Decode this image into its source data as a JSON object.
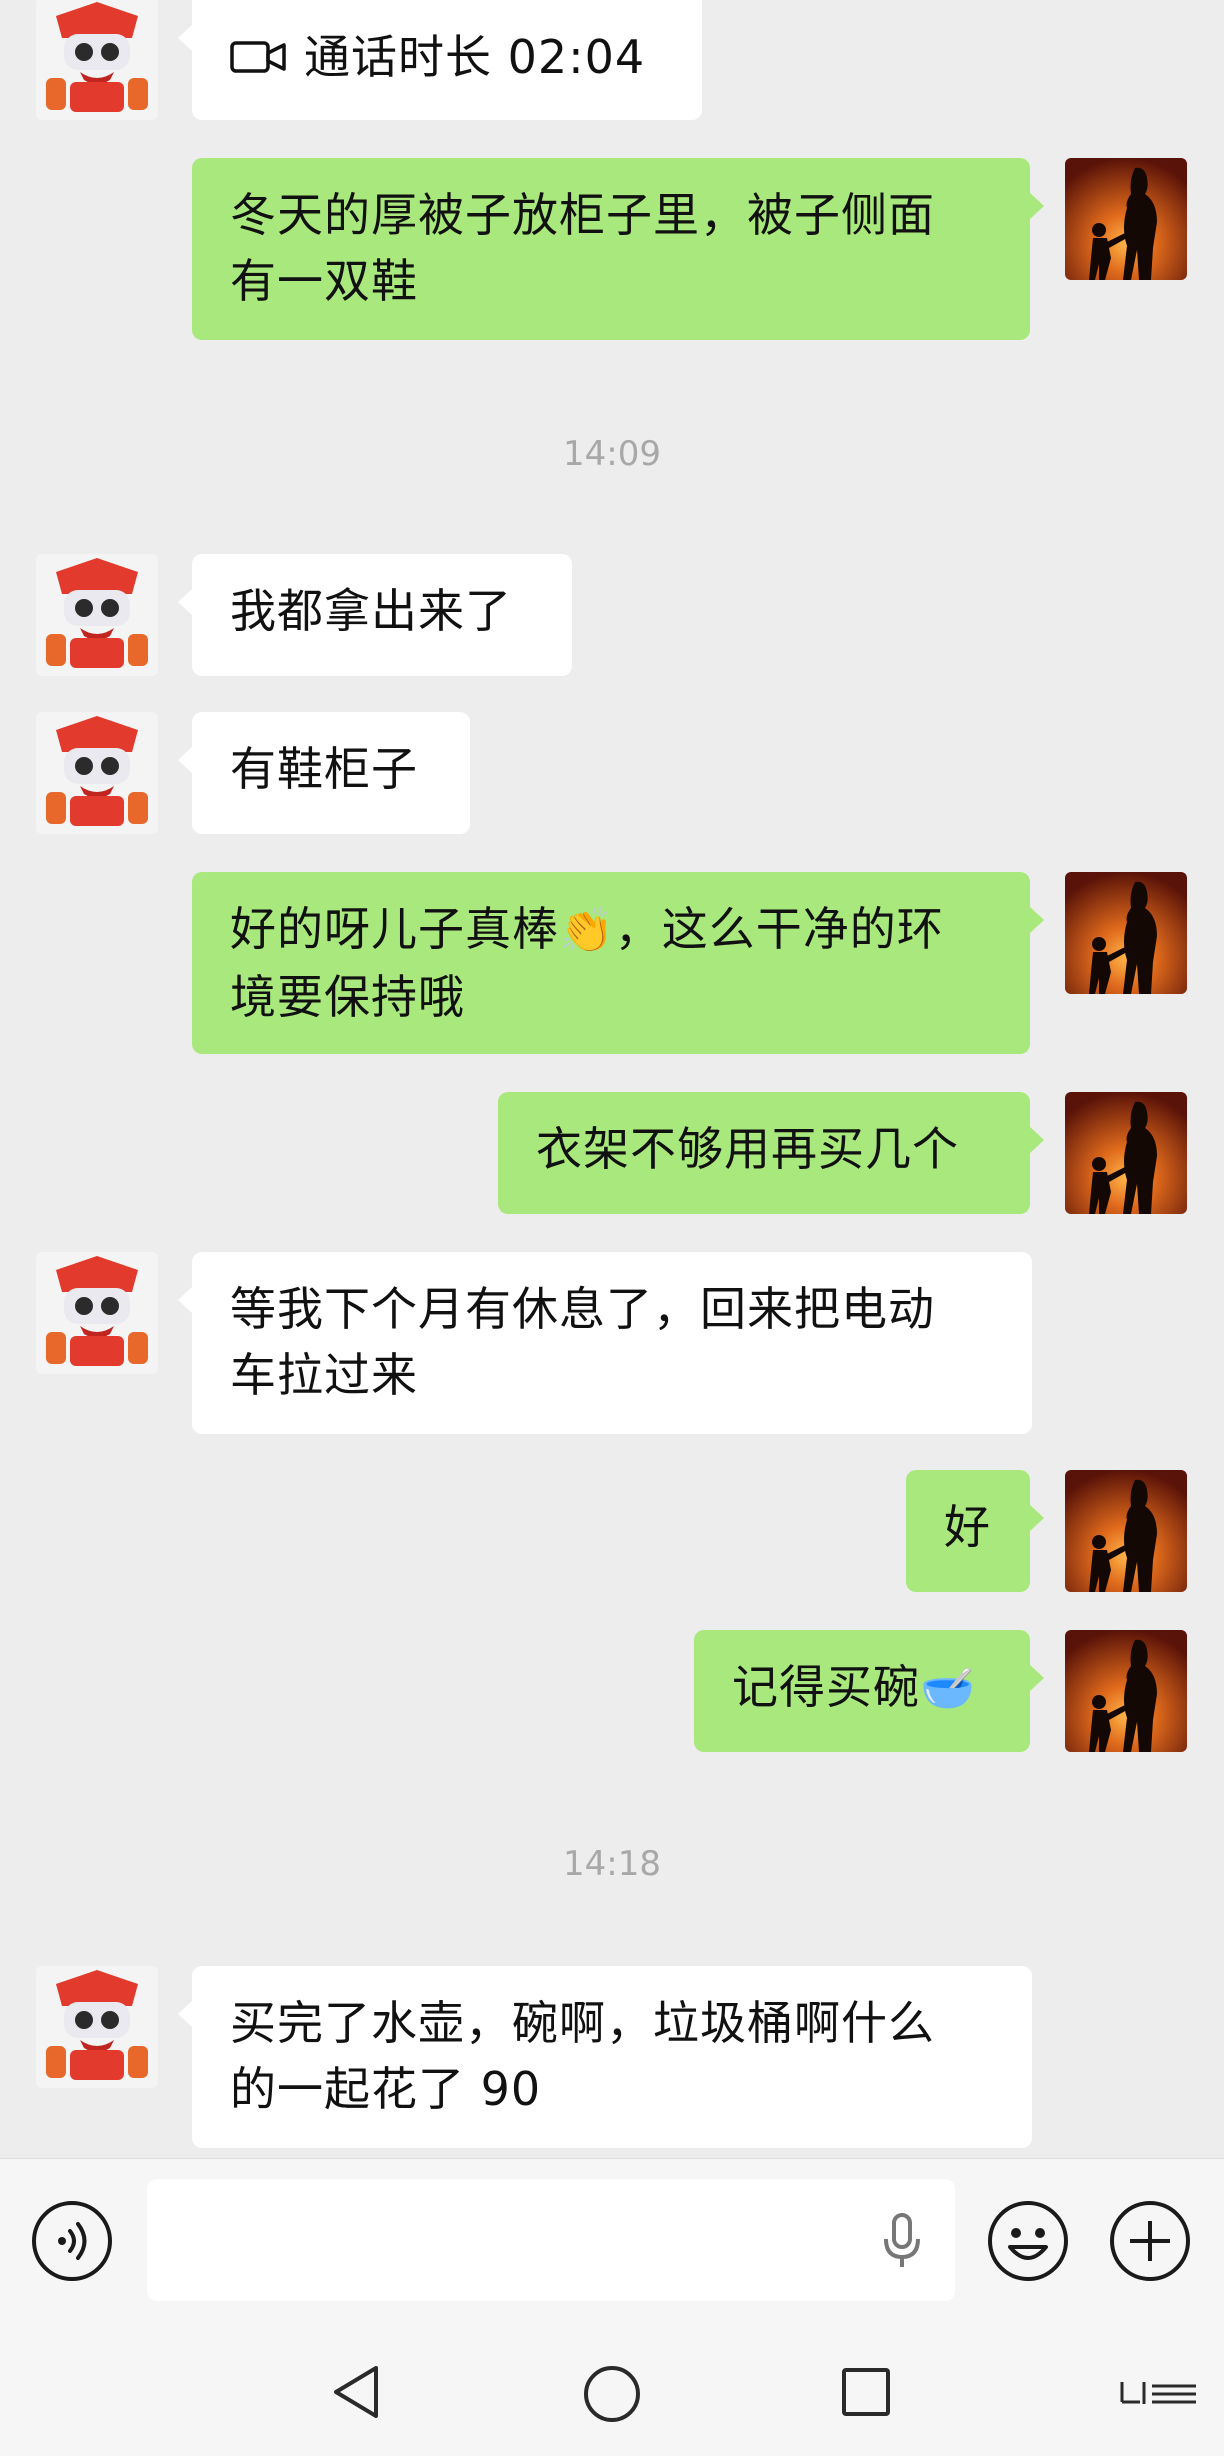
{
  "messages": {
    "call": {
      "label": "通话时长 02:04",
      "icon": "video-call-icon"
    },
    "m1": {
      "text_line1": "冬天的厚被子放柜子里，被子侧面",
      "text_line2": "有一双鞋"
    },
    "time1": "14:09",
    "m2": {
      "text": "我都拿出来了"
    },
    "m3": {
      "text": "有鞋柜子"
    },
    "m4": {
      "text_line1_a": "好的呀儿子真棒",
      "text_line1_emoji": "👏",
      "text_line1_b": "，这么干净的环",
      "text_line2": "境要保持哦"
    },
    "m5": {
      "text": "衣架不够用再买几个"
    },
    "m6": {
      "text_line1": "等我下个月有休息了，回来把电动",
      "text_line2": "车拉过来"
    },
    "m7": {
      "text": "好"
    },
    "m8": {
      "text": "记得买碗",
      "emoji": "🥣"
    },
    "time2": "14:18",
    "m9": {
      "text_line1": "买完了水壶，碗啊，垃圾桶啊什么",
      "text_line2": "的一起花了 90"
    }
  },
  "input_bar": {
    "voice_icon": "voice-toggle-icon",
    "mic_icon": "microphone-icon",
    "emoji_icon": "emoji-icon",
    "plus_icon": "plus-icon",
    "value": ""
  },
  "nav_bar": {
    "back_icon": "back-triangle-icon",
    "home_icon": "home-circle-icon",
    "recents_icon": "recents-square-icon",
    "menu_icon": "menu-icon"
  },
  "colors": {
    "background": "#ededed",
    "outgoing_bubble": "#a9e87c",
    "incoming_bubble": "#ffffff",
    "timestamp": "#a8a8a8"
  }
}
